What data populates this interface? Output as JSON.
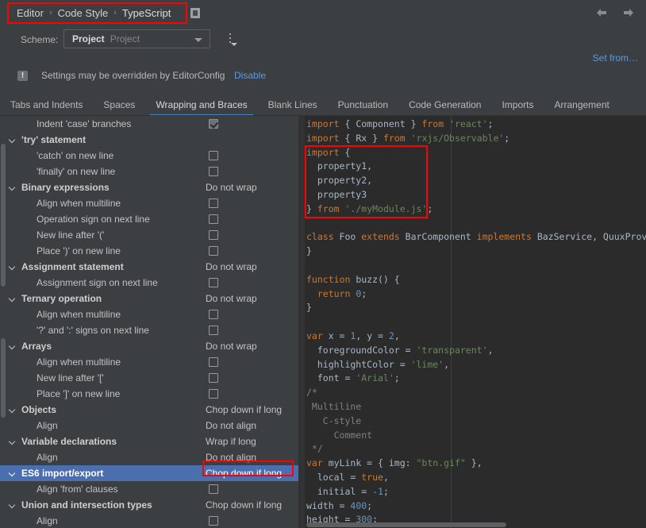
{
  "window": {
    "breadcrumb": [
      "Editor",
      "Code Style",
      "TypeScript"
    ],
    "separator": "›",
    "nav_back": "back-arrow",
    "nav_forward": "forward-arrow"
  },
  "scheme": {
    "label": "Scheme:",
    "value": "Project",
    "sub_value": "Project",
    "options_icon": "kebab-menu-icon"
  },
  "links": {
    "set_from": "Set from…"
  },
  "editorconfig": {
    "icon": "!",
    "message": "Settings may be overridden by EditorConfig",
    "disable_label": "Disable"
  },
  "tabs": [
    {
      "label": "Tabs and Indents",
      "active": false
    },
    {
      "label": "Spaces",
      "active": false
    },
    {
      "label": "Wrapping and Braces",
      "active": true
    },
    {
      "label": "Blank Lines",
      "active": false
    },
    {
      "label": "Punctuation",
      "active": false
    },
    {
      "label": "Code Generation",
      "active": false
    },
    {
      "label": "Imports",
      "active": false
    },
    {
      "label": "Arrangement",
      "active": false
    }
  ],
  "tree": {
    "rows": [
      {
        "label": "Indent 'case' branches",
        "type": "child",
        "control": "checkbox",
        "checked": true,
        "selected": false
      },
      {
        "label": "'try' statement",
        "type": "group",
        "control": "none",
        "checked": false,
        "selected": false
      },
      {
        "label": "'catch' on new line",
        "type": "child",
        "control": "checkbox",
        "checked": false,
        "selected": false
      },
      {
        "label": "'finally' on new line",
        "type": "child",
        "control": "checkbox",
        "checked": false,
        "selected": false
      },
      {
        "label": "Binary expressions",
        "type": "group",
        "control": "value",
        "value": "Do not wrap",
        "selected": false
      },
      {
        "label": "Align when multiline",
        "type": "child",
        "control": "checkbox",
        "checked": false,
        "selected": false
      },
      {
        "label": "Operation sign on next line",
        "type": "child",
        "control": "checkbox",
        "checked": false,
        "selected": false
      },
      {
        "label": "New line after '('",
        "type": "child",
        "control": "checkbox",
        "checked": false,
        "selected": false
      },
      {
        "label": "Place ')' on new line",
        "type": "child",
        "control": "checkbox",
        "checked": false,
        "selected": false
      },
      {
        "label": "Assignment statement",
        "type": "group",
        "control": "value",
        "value": "Do not wrap",
        "selected": false
      },
      {
        "label": "Assignment sign on next line",
        "type": "child",
        "control": "checkbox",
        "checked": false,
        "selected": false
      },
      {
        "label": "Ternary operation",
        "type": "group",
        "control": "value",
        "value": "Do not wrap",
        "selected": false
      },
      {
        "label": "Align when multiline",
        "type": "child",
        "control": "checkbox",
        "checked": false,
        "selected": false
      },
      {
        "label": "'?' and ':' signs on next line",
        "type": "child",
        "control": "checkbox",
        "checked": false,
        "selected": false
      },
      {
        "label": "Arrays",
        "type": "group",
        "control": "value",
        "value": "Do not wrap",
        "selected": false
      },
      {
        "label": "Align when multiline",
        "type": "child",
        "control": "checkbox",
        "checked": false,
        "selected": false
      },
      {
        "label": "New line after '['",
        "type": "child",
        "control": "checkbox",
        "checked": false,
        "selected": false
      },
      {
        "label": "Place ']' on new line",
        "type": "child",
        "control": "checkbox",
        "checked": false,
        "selected": false
      },
      {
        "label": "Objects",
        "type": "group",
        "control": "value",
        "value": "Chop down if long",
        "selected": false
      },
      {
        "label": "Align",
        "type": "child",
        "control": "value",
        "value": "Do not align",
        "selected": false
      },
      {
        "label": "Variable declarations",
        "type": "group",
        "control": "value",
        "value": "Wrap if long",
        "selected": false
      },
      {
        "label": "Align",
        "type": "child",
        "control": "value",
        "value": "Do not align",
        "selected": false
      },
      {
        "label": "ES6 import/export",
        "type": "group",
        "control": "value",
        "value": "Chop down if long",
        "selected": true
      },
      {
        "label": "Align 'from' clauses",
        "type": "child",
        "control": "checkbox",
        "checked": false,
        "selected": false
      },
      {
        "label": "Union and intersection types",
        "type": "group",
        "control": "value",
        "value": "Chop down if long",
        "selected": false
      },
      {
        "label": "Align",
        "type": "child",
        "control": "checkbox",
        "checked": false,
        "selected": false
      }
    ]
  },
  "preview": {
    "language": "TypeScript",
    "lines": [
      [
        {
          "t": "import",
          "c": "kw"
        },
        {
          "t": " ",
          "c": "dot"
        },
        {
          "t": "{ Component } ",
          "c": "id"
        },
        {
          "t": "from",
          "c": "kw"
        },
        {
          "t": " ",
          "c": "dot"
        },
        {
          "t": "'react'",
          "c": "str"
        },
        {
          "t": ";",
          "c": "id"
        }
      ],
      [
        {
          "t": "import",
          "c": "kw"
        },
        {
          "t": " ",
          "c": "dot"
        },
        {
          "t": "{ Rx } ",
          "c": "id"
        },
        {
          "t": "from",
          "c": "kw"
        },
        {
          "t": " ",
          "c": "dot"
        },
        {
          "t": "'rxjs/Observable'",
          "c": "str"
        },
        {
          "t": ";",
          "c": "id"
        }
      ],
      [
        {
          "t": "import",
          "c": "kw"
        },
        {
          "t": " {",
          "c": "id"
        }
      ],
      [
        {
          "t": "  property1,",
          "c": "id"
        }
      ],
      [
        {
          "t": "  property2,",
          "c": "id"
        }
      ],
      [
        {
          "t": "  property3",
          "c": "id"
        }
      ],
      [
        {
          "t": "} ",
          "c": "id"
        },
        {
          "t": "from",
          "c": "kw"
        },
        {
          "t": " ",
          "c": "dot"
        },
        {
          "t": "'./myModule.js'",
          "c": "str"
        },
        {
          "t": ";",
          "c": "id"
        }
      ],
      [],
      [
        {
          "t": "class",
          "c": "kw"
        },
        {
          "t": " Foo ",
          "c": "id"
        },
        {
          "t": "extends",
          "c": "kw"
        },
        {
          "t": " BarComponent ",
          "c": "id"
        },
        {
          "t": "implements",
          "c": "kw"
        },
        {
          "t": " BazService, QuuxProvider {",
          "c": "id"
        }
      ],
      [
        {
          "t": "}",
          "c": "id"
        }
      ],
      [],
      [
        {
          "t": "function",
          "c": "kw"
        },
        {
          "t": " buzz() {",
          "c": "id"
        }
      ],
      [
        {
          "t": "  ",
          "c": "dot"
        },
        {
          "t": "return",
          "c": "kw"
        },
        {
          "t": " ",
          "c": "dot"
        },
        {
          "t": "0",
          "c": "num"
        },
        {
          "t": ";",
          "c": "id"
        }
      ],
      [
        {
          "t": "}",
          "c": "id"
        }
      ],
      [],
      [
        {
          "t": "var",
          "c": "kw"
        },
        {
          "t": " x = ",
          "c": "id"
        },
        {
          "t": "1",
          "c": "num"
        },
        {
          "t": ", y = ",
          "c": "id"
        },
        {
          "t": "2",
          "c": "num"
        },
        {
          "t": ",",
          "c": "id"
        }
      ],
      [
        {
          "t": "  foregroundColor = ",
          "c": "id"
        },
        {
          "t": "'transparent'",
          "c": "str"
        },
        {
          "t": ",",
          "c": "id"
        }
      ],
      [
        {
          "t": "  highlightColor = ",
          "c": "id"
        },
        {
          "t": "'lime'",
          "c": "str"
        },
        {
          "t": ",",
          "c": "id"
        }
      ],
      [
        {
          "t": "  font = ",
          "c": "id"
        },
        {
          "t": "'Arial'",
          "c": "str"
        },
        {
          "t": ";",
          "c": "id"
        }
      ],
      [
        {
          "t": "/*",
          "c": "cmt"
        }
      ],
      [
        {
          "t": " Multiline",
          "c": "cmt"
        }
      ],
      [
        {
          "t": "   C-style",
          "c": "cmt"
        }
      ],
      [
        {
          "t": "     Comment",
          "c": "cmt"
        }
      ],
      [
        {
          "t": " */",
          "c": "cmt"
        }
      ],
      [
        {
          "t": "var",
          "c": "kw"
        },
        {
          "t": " myLink = { img: ",
          "c": "id"
        },
        {
          "t": "\"btn.gif\"",
          "c": "str"
        },
        {
          "t": " },",
          "c": "id"
        }
      ],
      [
        {
          "t": "  local = ",
          "c": "id"
        },
        {
          "t": "true",
          "c": "kw"
        },
        {
          "t": ",",
          "c": "id"
        }
      ],
      [
        {
          "t": "  initial = ",
          "c": "id"
        },
        {
          "t": "-1",
          "c": "num"
        },
        {
          "t": ";",
          "c": "id"
        }
      ],
      [
        {
          "t": "width = ",
          "c": "id"
        },
        {
          "t": "400",
          "c": "num"
        },
        {
          "t": ";",
          "c": "id"
        }
      ],
      [
        {
          "t": "height = ",
          "c": "id"
        },
        {
          "t": "300",
          "c": "num"
        },
        {
          "t": ";",
          "c": "id"
        }
      ]
    ]
  },
  "colors": {
    "background": "#3c3f41",
    "code_background": "#2b2b2b",
    "selection": "#4b6eaf",
    "accent_link": "#5a9ae0",
    "tab_underline": "#4a88c7",
    "highlight_box": "#ff0000",
    "keyword": "#cc7832",
    "string": "#6a8759",
    "number": "#6897bb",
    "identifier": "#a9b7c6",
    "comment": "#808080"
  }
}
